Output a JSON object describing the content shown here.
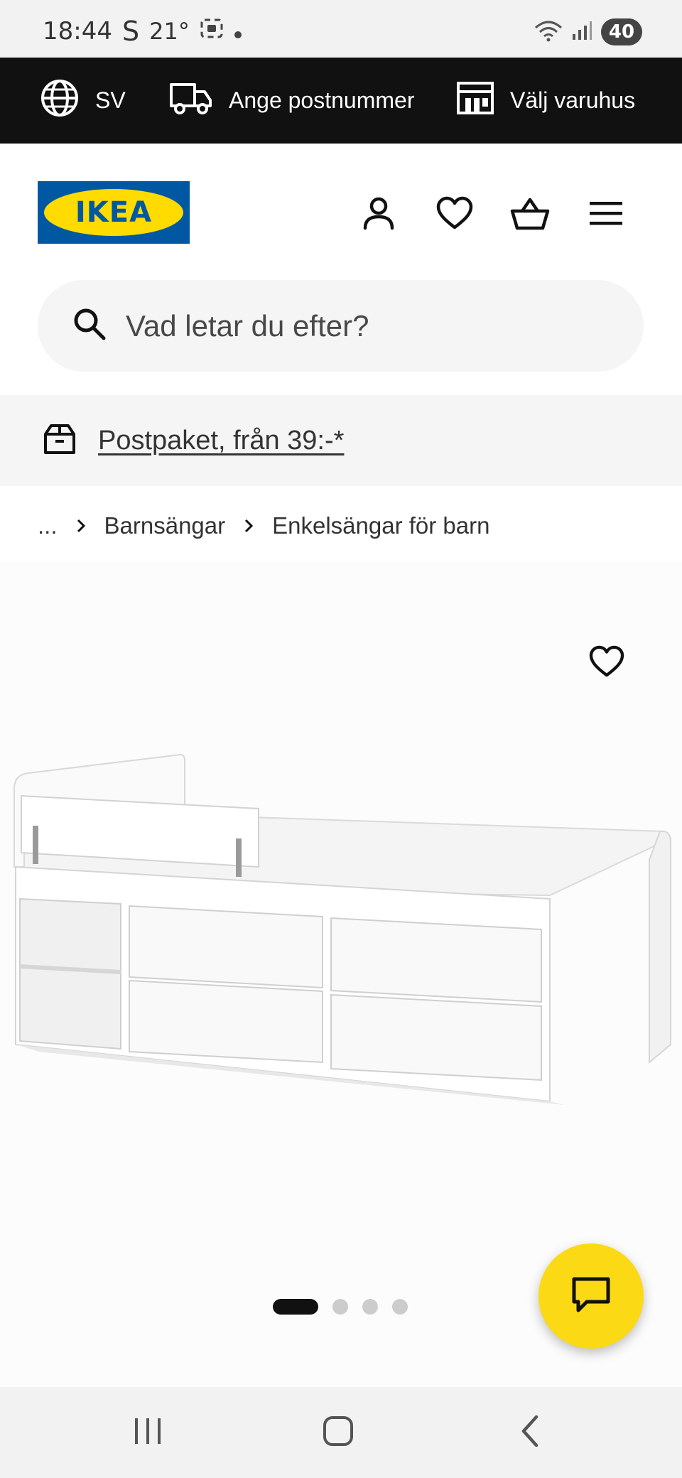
{
  "status_bar": {
    "time": "18:44",
    "carrier_mark": "S",
    "temperature": "21°",
    "battery": "40",
    "icons": [
      "screenshot-icon",
      "wifi-icon",
      "signal-icon"
    ]
  },
  "top_bar": {
    "language": "SV",
    "postal_code_label": "Ange postnummer",
    "store_label": "Välj varuhus"
  },
  "header": {
    "logo_text": "IKEA",
    "icons": [
      "account-icon",
      "wishlist-icon",
      "cart-icon",
      "menu-icon"
    ]
  },
  "search": {
    "placeholder": "Vad letar du efter?"
  },
  "promo": {
    "text": "Postpaket, från 39:-*"
  },
  "breadcrumb": {
    "ellipsis": "...",
    "items": [
      "Barnsängar",
      "Enkelsängar för barn"
    ]
  },
  "carousel": {
    "total": 4,
    "active_index": 0
  },
  "colors": {
    "topbar_bg": "#111111",
    "ikea_blue": "#0058a3",
    "ikea_yellow": "#ffdb00",
    "chat_fab": "#fbd914"
  }
}
